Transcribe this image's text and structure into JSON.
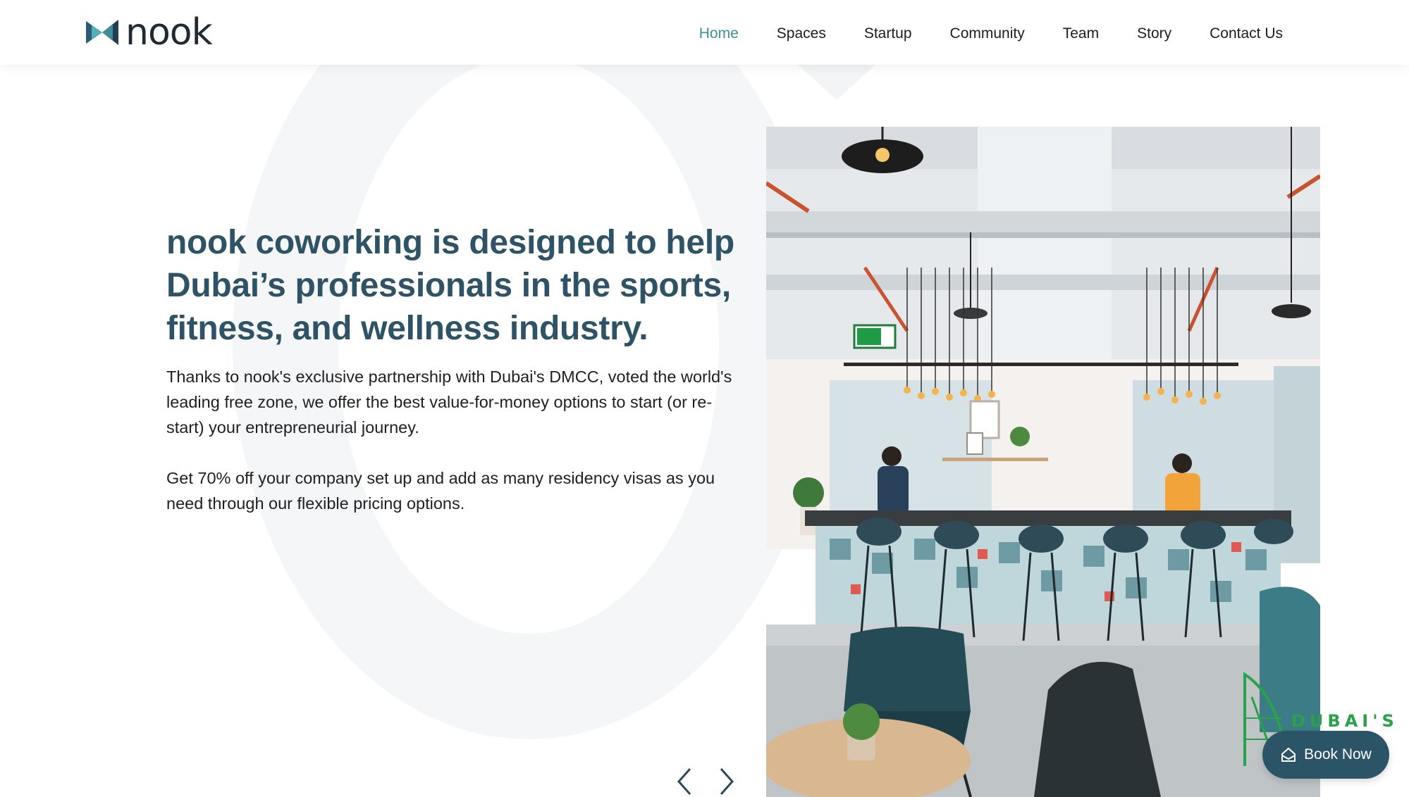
{
  "brand": {
    "name": "nook",
    "accent_color": "#3e8f93",
    "heading_color": "#2e5266",
    "button_color": "#2b5567"
  },
  "nav": {
    "items": [
      {
        "label": "Home",
        "active": true
      },
      {
        "label": "Spaces",
        "active": false
      },
      {
        "label": "Startup",
        "active": false
      },
      {
        "label": "Community",
        "active": false
      },
      {
        "label": "Team",
        "active": false
      },
      {
        "label": "Story",
        "active": false
      },
      {
        "label": "Contact Us",
        "active": false
      }
    ]
  },
  "hero": {
    "title": "nook coworking is designed to help Dubai’s professionals in the sports, fitness, and wellness industry.",
    "paragraph_1": "Thanks to nook's exclusive partnership with Dubai's DMCC, voted the world's leading free zone, we offer the best value-for-money options to start (or re-start) your entrepreneurial journey.",
    "paragraph_2": "Get 70% off your company set up and add as many residency visas as you need through our flexible pricing options."
  },
  "slider": {
    "prev_icon": "chevron-left-icon",
    "next_icon": "chevron-right-icon"
  },
  "badge": {
    "text": "DUBAI'S"
  },
  "book_now": {
    "label": "Book Now",
    "icon": "home-icon"
  }
}
